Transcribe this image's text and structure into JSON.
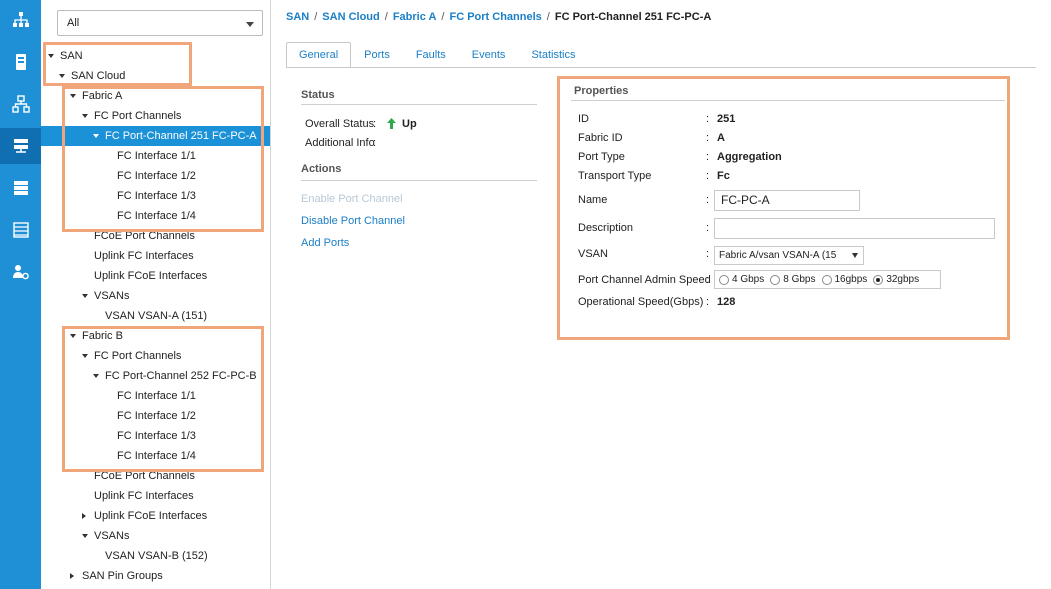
{
  "tree": {
    "filter_value": "All",
    "nodes": [
      {
        "label": "SAN",
        "indent": 0,
        "toggle": "down"
      },
      {
        "label": "SAN Cloud",
        "indent": 1,
        "toggle": "down"
      },
      {
        "label": "Fabric A",
        "indent": 2,
        "toggle": "down"
      },
      {
        "label": "FC Port Channels",
        "indent": 3,
        "toggle": "down"
      },
      {
        "label": "FC Port-Channel 251 FC-PC-A",
        "indent": 4,
        "toggle": "down",
        "selected": true
      },
      {
        "label": "FC Interface 1/1",
        "indent": 5,
        "toggle": "none"
      },
      {
        "label": "FC Interface 1/2",
        "indent": 5,
        "toggle": "none"
      },
      {
        "label": "FC Interface 1/3",
        "indent": 5,
        "toggle": "none"
      },
      {
        "label": "FC Interface 1/4",
        "indent": 5,
        "toggle": "none"
      },
      {
        "label": "FCoE Port Channels",
        "indent": 3,
        "toggle": "none"
      },
      {
        "label": "Uplink FC Interfaces",
        "indent": 3,
        "toggle": "none"
      },
      {
        "label": "Uplink FCoE Interfaces",
        "indent": 3,
        "toggle": "none"
      },
      {
        "label": "VSANs",
        "indent": 3,
        "toggle": "down"
      },
      {
        "label": "VSAN VSAN-A (151)",
        "indent": 4,
        "toggle": "none"
      },
      {
        "label": "Fabric B",
        "indent": 2,
        "toggle": "down"
      },
      {
        "label": "FC Port Channels",
        "indent": 3,
        "toggle": "down"
      },
      {
        "label": "FC Port-Channel 252 FC-PC-B",
        "indent": 4,
        "toggle": "down"
      },
      {
        "label": "FC Interface 1/1",
        "indent": 5,
        "toggle": "none"
      },
      {
        "label": "FC Interface 1/2",
        "indent": 5,
        "toggle": "none"
      },
      {
        "label": "FC Interface 1/3",
        "indent": 5,
        "toggle": "none"
      },
      {
        "label": "FC Interface 1/4",
        "indent": 5,
        "toggle": "none"
      },
      {
        "label": "FCoE Port Channels",
        "indent": 3,
        "toggle": "none"
      },
      {
        "label": "Uplink FC Interfaces",
        "indent": 3,
        "toggle": "none"
      },
      {
        "label": "Uplink FCoE Interfaces",
        "indent": 3,
        "toggle": "right"
      },
      {
        "label": "VSANs",
        "indent": 3,
        "toggle": "down"
      },
      {
        "label": "VSAN VSAN-B (152)",
        "indent": 4,
        "toggle": "none"
      },
      {
        "label": "SAN Pin Groups",
        "indent": 2,
        "toggle": "right"
      }
    ]
  },
  "rail": {
    "icons": [
      "equipment-icon",
      "servers-icon",
      "lan-icon",
      "san-icon",
      "vm-icon",
      "storage-icon",
      "admin-icon"
    ],
    "active_index": 3
  },
  "breadcrumb": {
    "items": [
      "SAN",
      "SAN Cloud",
      "Fabric A",
      "FC Port Channels"
    ],
    "current": "FC Port-Channel 251 FC-PC-A"
  },
  "tabs": [
    "General",
    "Ports",
    "Faults",
    "Events",
    "Statistics"
  ],
  "status": {
    "title": "Status",
    "overall_label": "Overall Status",
    "overall_value": "Up",
    "additional_label": "Additional Info",
    "additional_value": ""
  },
  "actions": {
    "title": "Actions",
    "items": [
      {
        "label": "Enable Port Channel",
        "disabled": true
      },
      {
        "label": "Disable Port Channel",
        "disabled": false
      },
      {
        "label": "Add Ports",
        "disabled": false
      }
    ]
  },
  "properties": {
    "title": "Properties",
    "id_label": "ID",
    "id_value": "251",
    "fabric_label": "Fabric ID",
    "fabric_value": "A",
    "port_type_label": "Port Type",
    "port_type_value": "Aggregation",
    "transport_label": "Transport Type",
    "transport_value": "Fc",
    "name_label": "Name",
    "name_value": "FC-PC-A",
    "description_label": "Description",
    "description_value": "",
    "vsan_label": "VSAN",
    "vsan_value": "Fabric A/vsan VSAN-A (15",
    "speed_label": "Port Channel Admin Speed",
    "speed_options": [
      "4 Gbps",
      "8 Gbps",
      "16gbps",
      "32gbps"
    ],
    "speed_selected": "32gbps",
    "op_speed_label": "Operational Speed(Gbps)",
    "op_speed_value": "128"
  },
  "colors": {
    "accent": "#1b91d8",
    "rail": "#1f8fd6",
    "link": "#1b7fc6",
    "highlight": "#f0a57a",
    "status_up": "#2fa84f"
  }
}
